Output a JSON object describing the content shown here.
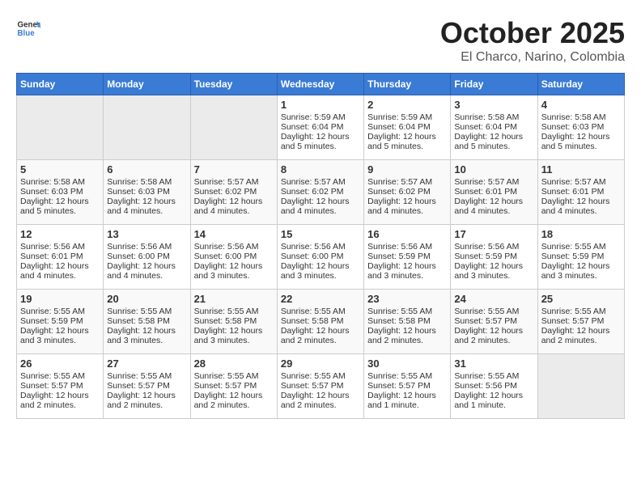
{
  "header": {
    "logo_general": "General",
    "logo_blue": "Blue",
    "title": "October 2025",
    "subtitle": "El Charco, Narino, Colombia"
  },
  "weekdays": [
    "Sunday",
    "Monday",
    "Tuesday",
    "Wednesday",
    "Thursday",
    "Friday",
    "Saturday"
  ],
  "weeks": [
    [
      {
        "day": "",
        "empty": true
      },
      {
        "day": "",
        "empty": true
      },
      {
        "day": "",
        "empty": true
      },
      {
        "day": "1",
        "sunrise": "5:59 AM",
        "sunset": "6:04 PM",
        "daylight": "12 hours and 5 minutes."
      },
      {
        "day": "2",
        "sunrise": "5:59 AM",
        "sunset": "6:04 PM",
        "daylight": "12 hours and 5 minutes."
      },
      {
        "day": "3",
        "sunrise": "5:58 AM",
        "sunset": "6:04 PM",
        "daylight": "12 hours and 5 minutes."
      },
      {
        "day": "4",
        "sunrise": "5:58 AM",
        "sunset": "6:03 PM",
        "daylight": "12 hours and 5 minutes."
      }
    ],
    [
      {
        "day": "5",
        "sunrise": "5:58 AM",
        "sunset": "6:03 PM",
        "daylight": "12 hours and 5 minutes."
      },
      {
        "day": "6",
        "sunrise": "5:58 AM",
        "sunset": "6:03 PM",
        "daylight": "12 hours and 4 minutes."
      },
      {
        "day": "7",
        "sunrise": "5:57 AM",
        "sunset": "6:02 PM",
        "daylight": "12 hours and 4 minutes."
      },
      {
        "day": "8",
        "sunrise": "5:57 AM",
        "sunset": "6:02 PM",
        "daylight": "12 hours and 4 minutes."
      },
      {
        "day": "9",
        "sunrise": "5:57 AM",
        "sunset": "6:02 PM",
        "daylight": "12 hours and 4 minutes."
      },
      {
        "day": "10",
        "sunrise": "5:57 AM",
        "sunset": "6:01 PM",
        "daylight": "12 hours and 4 minutes."
      },
      {
        "day": "11",
        "sunrise": "5:57 AM",
        "sunset": "6:01 PM",
        "daylight": "12 hours and 4 minutes."
      }
    ],
    [
      {
        "day": "12",
        "sunrise": "5:56 AM",
        "sunset": "6:01 PM",
        "daylight": "12 hours and 4 minutes."
      },
      {
        "day": "13",
        "sunrise": "5:56 AM",
        "sunset": "6:00 PM",
        "daylight": "12 hours and 4 minutes."
      },
      {
        "day": "14",
        "sunrise": "5:56 AM",
        "sunset": "6:00 PM",
        "daylight": "12 hours and 3 minutes."
      },
      {
        "day": "15",
        "sunrise": "5:56 AM",
        "sunset": "6:00 PM",
        "daylight": "12 hours and 3 minutes."
      },
      {
        "day": "16",
        "sunrise": "5:56 AM",
        "sunset": "5:59 PM",
        "daylight": "12 hours and 3 minutes."
      },
      {
        "day": "17",
        "sunrise": "5:56 AM",
        "sunset": "5:59 PM",
        "daylight": "12 hours and 3 minutes."
      },
      {
        "day": "18",
        "sunrise": "5:55 AM",
        "sunset": "5:59 PM",
        "daylight": "12 hours and 3 minutes."
      }
    ],
    [
      {
        "day": "19",
        "sunrise": "5:55 AM",
        "sunset": "5:59 PM",
        "daylight": "12 hours and 3 minutes."
      },
      {
        "day": "20",
        "sunrise": "5:55 AM",
        "sunset": "5:58 PM",
        "daylight": "12 hours and 3 minutes."
      },
      {
        "day": "21",
        "sunrise": "5:55 AM",
        "sunset": "5:58 PM",
        "daylight": "12 hours and 3 minutes."
      },
      {
        "day": "22",
        "sunrise": "5:55 AM",
        "sunset": "5:58 PM",
        "daylight": "12 hours and 2 minutes."
      },
      {
        "day": "23",
        "sunrise": "5:55 AM",
        "sunset": "5:58 PM",
        "daylight": "12 hours and 2 minutes."
      },
      {
        "day": "24",
        "sunrise": "5:55 AM",
        "sunset": "5:57 PM",
        "daylight": "12 hours and 2 minutes."
      },
      {
        "day": "25",
        "sunrise": "5:55 AM",
        "sunset": "5:57 PM",
        "daylight": "12 hours and 2 minutes."
      }
    ],
    [
      {
        "day": "26",
        "sunrise": "5:55 AM",
        "sunset": "5:57 PM",
        "daylight": "12 hours and 2 minutes."
      },
      {
        "day": "27",
        "sunrise": "5:55 AM",
        "sunset": "5:57 PM",
        "daylight": "12 hours and 2 minutes."
      },
      {
        "day": "28",
        "sunrise": "5:55 AM",
        "sunset": "5:57 PM",
        "daylight": "12 hours and 2 minutes."
      },
      {
        "day": "29",
        "sunrise": "5:55 AM",
        "sunset": "5:57 PM",
        "daylight": "12 hours and 2 minutes."
      },
      {
        "day": "30",
        "sunrise": "5:55 AM",
        "sunset": "5:57 PM",
        "daylight": "12 hours and 1 minute."
      },
      {
        "day": "31",
        "sunrise": "5:55 AM",
        "sunset": "5:56 PM",
        "daylight": "12 hours and 1 minute."
      },
      {
        "day": "",
        "empty": true
      }
    ]
  ],
  "labels": {
    "sunrise": "Sunrise:",
    "sunset": "Sunset:",
    "daylight": "Daylight:"
  }
}
